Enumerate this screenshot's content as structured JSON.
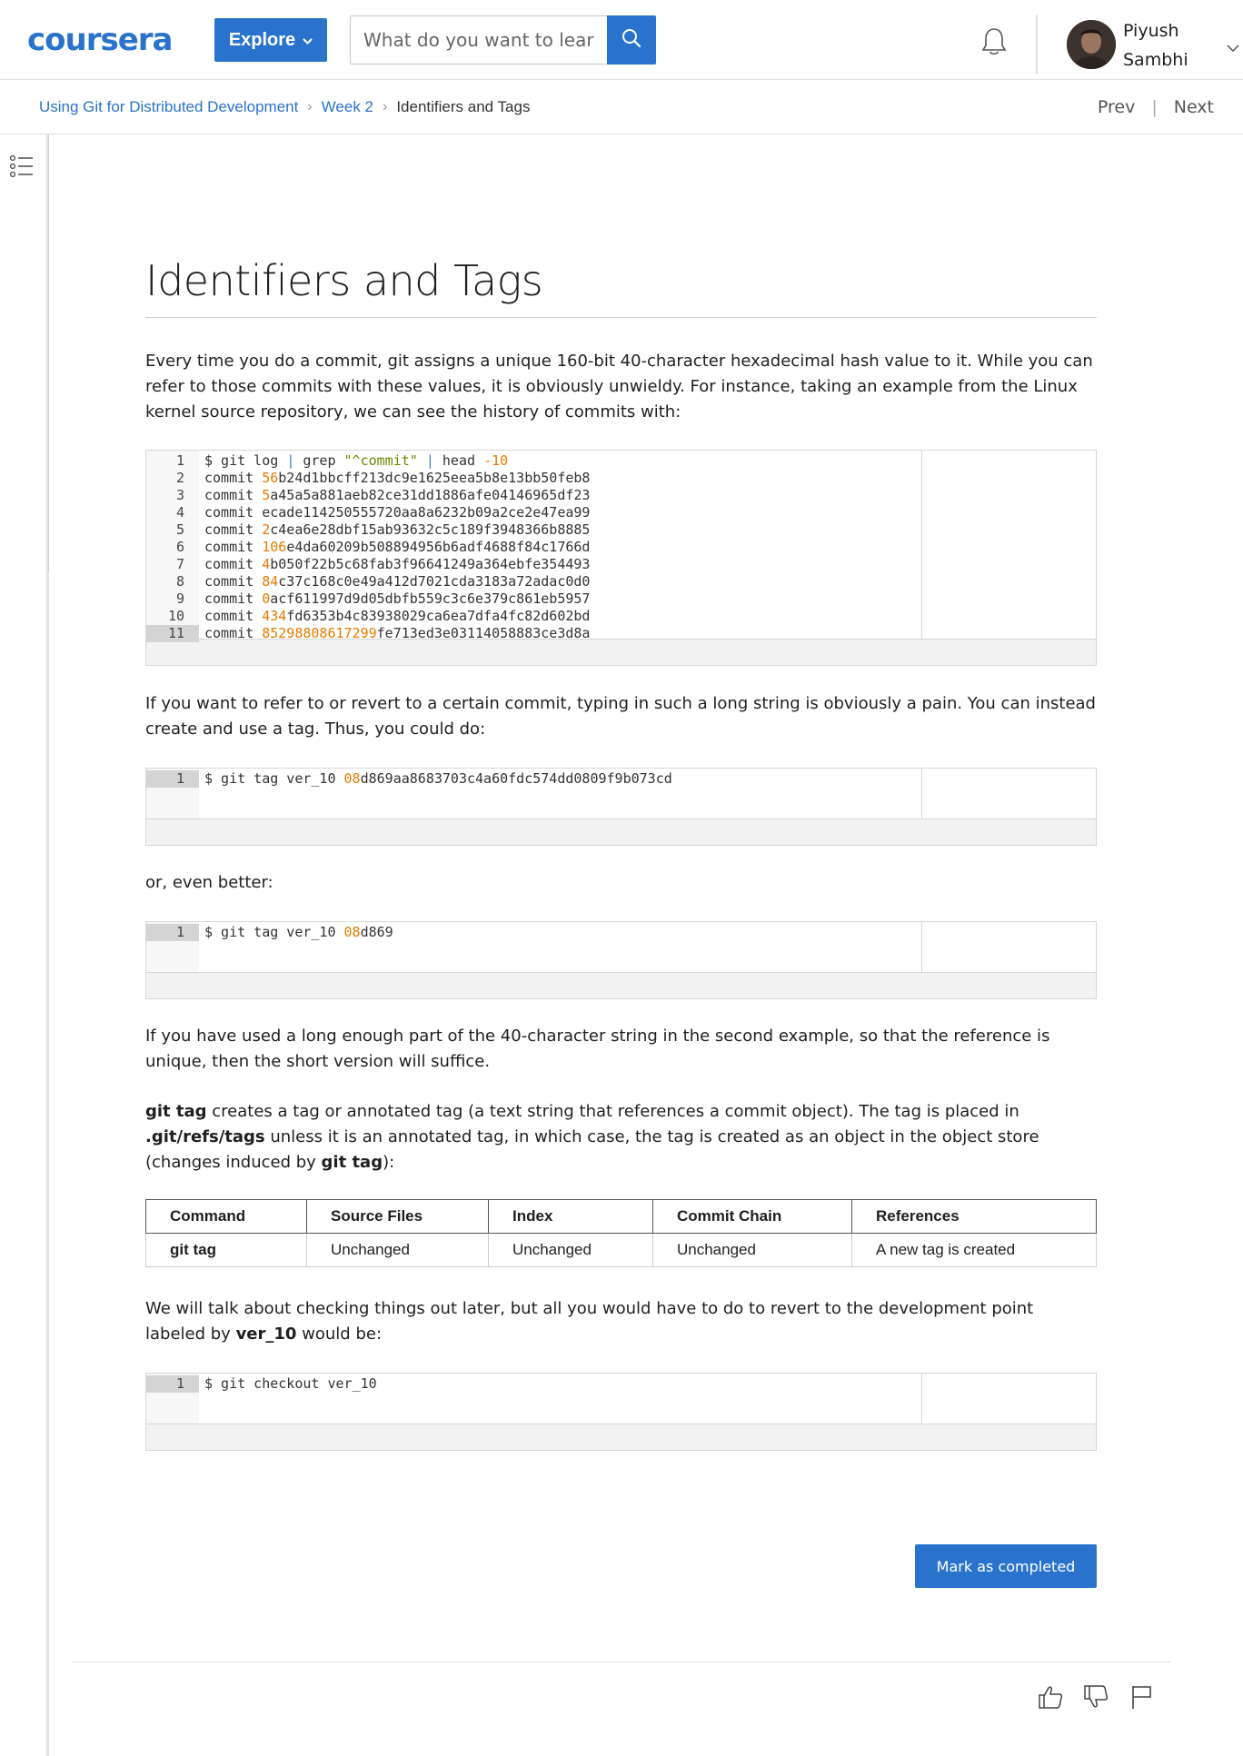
{
  "header": {
    "logo": "coursera",
    "explore_label": "Explore",
    "search_placeholder": "What do you want to learn?",
    "user_first": "Piyush",
    "user_last": "Sambhi"
  },
  "breadcrumb": {
    "course": "Using Git for Distributed Development",
    "week": "Week 2",
    "current": "Identifiers and Tags",
    "prev": "Prev",
    "next": "Next"
  },
  "article": {
    "title": "Identifiers and Tags",
    "p1": "Every time you do a commit, git assigns a unique 160-bit 40-character hexadecimal hash value to it. While you can refer to those commits with these values, it is obviously unwieldy. For instance, taking an example from the Linux kernel source repository, we can see the history of commits with:",
    "p2": "If you want to refer to or revert to a certain commit, typing in such a long string is obviously a pain. You can instead create and use a tag. Thus, you could do:",
    "p3": "or, even better:",
    "p4": "If you have used a long enough part of the 40-character string in the second example, so that the reference is unique, then the short version will suffice.",
    "p5": {
      "b1": "git tag",
      "t1": " creates a tag or annotated tag (a text string that references a commit object). The tag is placed in ",
      "b2": ".git/refs/tags",
      "t2": " unless it is an annotated tag, in which case, the tag is created as an object in the object store (changes induced by ",
      "b3": "git tag",
      "t3": "):"
    },
    "p6": {
      "t1": "We will talk about checking things out later, but all you would have to do to revert to the development point labeled by ",
      "b1": "ver_10",
      "t2": " would be:"
    }
  },
  "code_blocks": {
    "log": {
      "line_numbers": [
        "1",
        "2",
        "3",
        "4",
        "5",
        "6",
        "7",
        "8",
        "9",
        "10",
        "11"
      ],
      "line1": {
        "a": "$ git log ",
        "p1": "|",
        "b": " grep ",
        "s": "\"^commit\"",
        "c": " ",
        "p2": "|",
        "d": " head ",
        "n": "-10"
      },
      "commits": [
        {
          "pre": "commit ",
          "num": "56",
          "rest": "b24d1bbcff213dc9e1625eea5b8e13bb50feb8"
        },
        {
          "pre": "commit ",
          "num": "5",
          "rest": "a45a5a881aeb82ce31dd1886afe04146965df23"
        },
        {
          "pre": "commit ",
          "num": "",
          "rest": "ecade114250555720aa8a6232b09a2ce2e47ea99"
        },
        {
          "pre": "commit ",
          "num": "2",
          "rest": "c4ea6e28dbf15ab93632c5c189f3948366b8885"
        },
        {
          "pre": "commit ",
          "num": "106",
          "rest": "e4da60209b508894956b6adf4688f84c1766d"
        },
        {
          "pre": "commit ",
          "num": "4",
          "rest": "b050f22b5c68fab3f96641249a364ebfe354493"
        },
        {
          "pre": "commit ",
          "num": "84",
          "rest": "c37c168c0e49a412d7021cda3183a72adac0d0"
        },
        {
          "pre": "commit ",
          "num": "0",
          "rest": "acf611997d9d05dbfb559c3c6e379c861eb5957"
        },
        {
          "pre": "commit ",
          "num": "434",
          "rest": "fd6353b4c83938029ca6ea7dfa4fc82d602bd"
        },
        {
          "pre": "commit ",
          "num": "85298808617299",
          "rest": "fe713ed3e03114058883ce3d8a"
        }
      ]
    },
    "tag_long": {
      "ln": "1",
      "pre": "$ git tag ver_10 ",
      "num": "08",
      "rest": "d869aa8683703c4a60fdc574dd0809f9b073cd"
    },
    "tag_short": {
      "ln": "1",
      "pre": "$ git tag ver_10 ",
      "num": "08",
      "rest": "d869"
    },
    "checkout": {
      "ln": "1",
      "text": "$ git checkout ver_10"
    }
  },
  "table": {
    "headers": [
      "Command",
      "Source Files",
      "Index",
      "Commit Chain",
      "References"
    ],
    "rows": [
      [
        "git tag",
        "Unchanged",
        "Unchanged",
        "Unchanged",
        "A new tag is created"
      ]
    ]
  },
  "footer": {
    "mark_completed": "Mark as completed"
  },
  "colors": {
    "brand": "#2a73cc",
    "code_number": "#e87a00",
    "code_string": "#6a8a00",
    "code_pipe": "#3b7bd1"
  },
  "icons": [
    "search-icon",
    "bell-icon",
    "chevron-down-icon",
    "outline-list-icon",
    "thumbs-up-icon",
    "thumbs-down-icon",
    "flag-icon"
  ]
}
